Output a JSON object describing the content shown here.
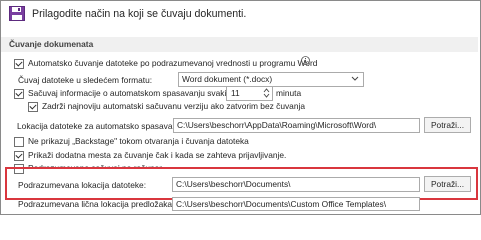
{
  "header": {
    "title": "Prilagodite način na koji se čuvaju dokumenti."
  },
  "section": {
    "title": "Čuvanje dokumenata"
  },
  "options": {
    "autosave_onedrive": {
      "label": "Automatsko čuvanje datoteke po podrazumevanoj vrednosti u programu Word",
      "checked": true
    },
    "save_format": {
      "label": "Čuvaj datoteke u sledećem formatu:",
      "value": "Word dokument (*.docx)"
    },
    "autorecover": {
      "label": "Sačuvaj informacije o automatskom spasavanju svakih",
      "value": "11",
      "unit": "minuta",
      "checked": true
    },
    "keep_last": {
      "label": "Zadrži najnoviju automatski sačuvanu verziju ako zatvorim bez čuvanja",
      "checked": true
    },
    "autorecover_location": {
      "label": "Lokacija datoteke za automatsko spasavanje:",
      "value": "C:\\Users\\beschorr\\AppData\\Roaming\\Microsoft\\Word\\",
      "button": "Potraži..."
    },
    "no_backstage": {
      "label": "Ne prikazuj „Backstage\" tokom otvaranja i čuvanja datoteka",
      "checked": false
    },
    "show_places": {
      "label": "Prikaži dodatna mesta za čuvanje čak i kada se zahteva prijavljivanje.",
      "checked": true
    },
    "save_to_computer": {
      "label": "Podrazumevano sačuvaj na računar",
      "checked": false
    },
    "default_location": {
      "label": "Podrazumevana lokacija datoteke:",
      "value": "C:\\Users\\beschorr\\Documents\\",
      "button": "Potraži..."
    },
    "template_location": {
      "label": "Podrazumevana lična lokacija predložaka:",
      "value": "C:\\Users\\beschorr\\Documents\\Custom Office Templates\\"
    }
  },
  "colors": {
    "highlight": "#d9363e",
    "section_bg": "#f0f0f0"
  }
}
